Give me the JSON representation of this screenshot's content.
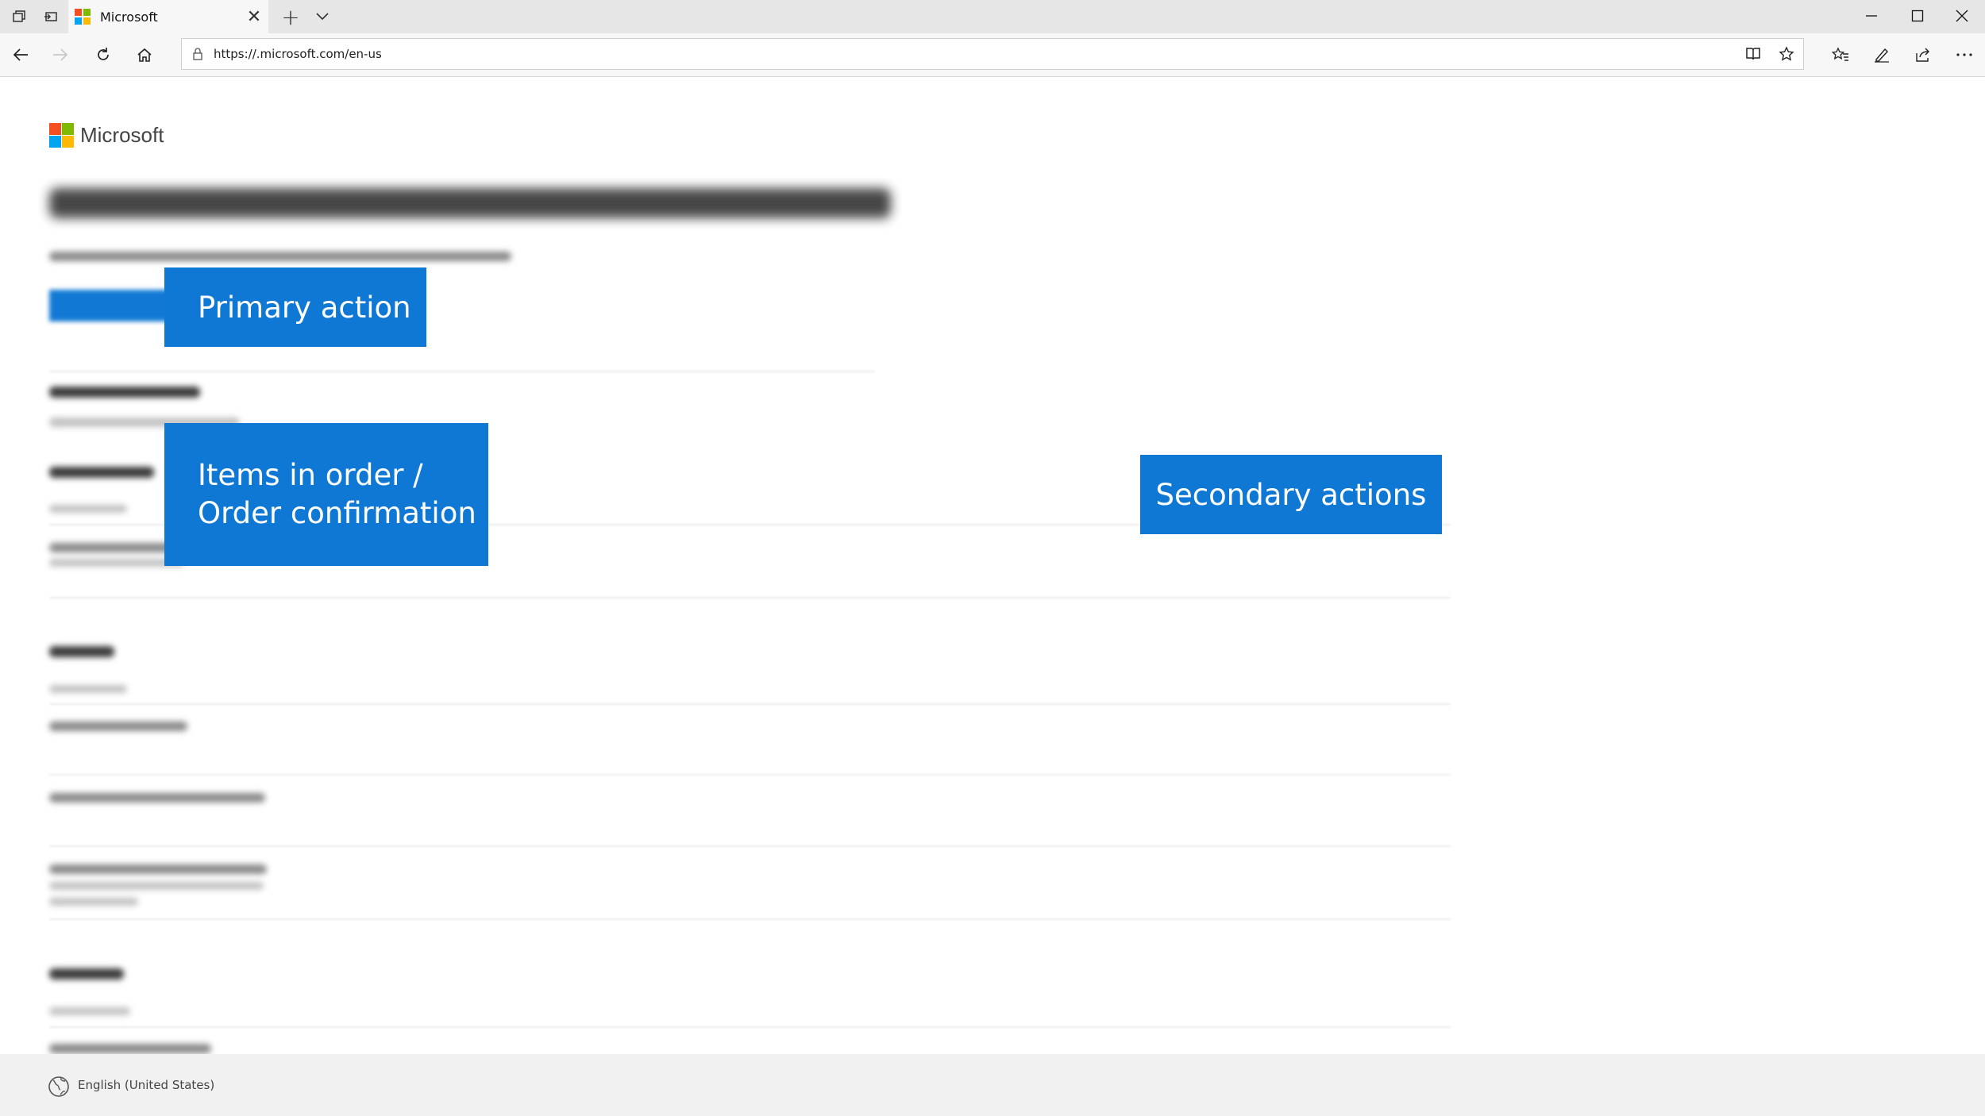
{
  "browser": {
    "tab_title": "Microsoft",
    "url": "https://.microsoft.com/en-us",
    "new_tab_symbol": "+",
    "close_tab_symbol": "✕"
  },
  "page": {
    "brand": "Microsoft",
    "brand_colors": [
      "#f25022",
      "#7fba00",
      "#00a4ef",
      "#ffb900"
    ],
    "accent_color": "#0f78d4",
    "callouts": {
      "primary": "Primary action",
      "items_line1": "Items in order /",
      "items_line2": "Order confirmation",
      "secondary": "Secondary actions"
    }
  },
  "footer": {
    "language": "English (United States)"
  },
  "icons": [
    "tabs-icon",
    "set-aside-tabs-icon",
    "chevron-down-icon",
    "minimize-icon",
    "maximize-icon",
    "close-window-icon",
    "back-icon",
    "forward-icon",
    "refresh-icon",
    "home-icon",
    "lock-icon",
    "reading-view-icon",
    "favorite-star-icon",
    "favorites-hub-icon",
    "pen-icon",
    "share-icon",
    "more-icon",
    "globe-icon"
  ]
}
